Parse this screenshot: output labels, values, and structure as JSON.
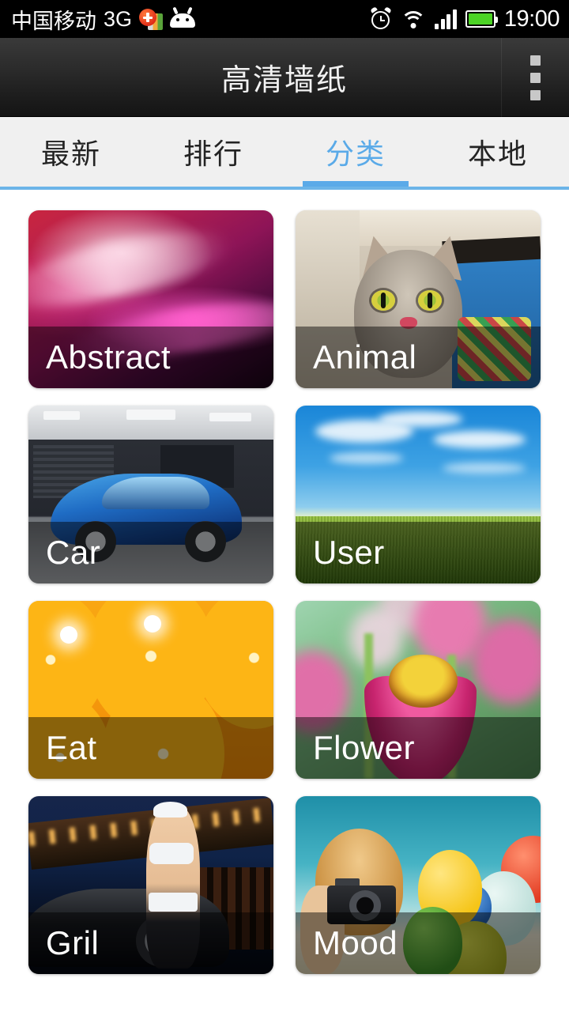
{
  "status_bar": {
    "carrier": "中国移动",
    "network": "3G",
    "icons": [
      "sim-card-icon",
      "android-robot-icon",
      "alarm-icon",
      "wifi-icon",
      "signal-bars-icon",
      "battery-icon"
    ],
    "clock": "19:00",
    "battery_color": "#4cd425"
  },
  "action_bar": {
    "title": "高清墙纸",
    "overflow_menu": "overflow-menu-icon"
  },
  "tabs": {
    "active_index": 2,
    "accent_color": "#5aaae8",
    "items": [
      {
        "label": "最新"
      },
      {
        "label": "排行"
      },
      {
        "label": "分类"
      },
      {
        "label": "本地"
      }
    ]
  },
  "grid": {
    "items": [
      {
        "label": "Abstract",
        "art": "art-abstract"
      },
      {
        "label": "Animal",
        "art": "art-animal"
      },
      {
        "label": "Car",
        "art": "art-car"
      },
      {
        "label": "User",
        "art": "art-user"
      },
      {
        "label": "Eat",
        "art": "art-eat"
      },
      {
        "label": "Flower",
        "art": "art-flower"
      },
      {
        "label": "Gril",
        "art": "art-gril"
      },
      {
        "label": "Mood",
        "art": "art-mood"
      }
    ]
  }
}
